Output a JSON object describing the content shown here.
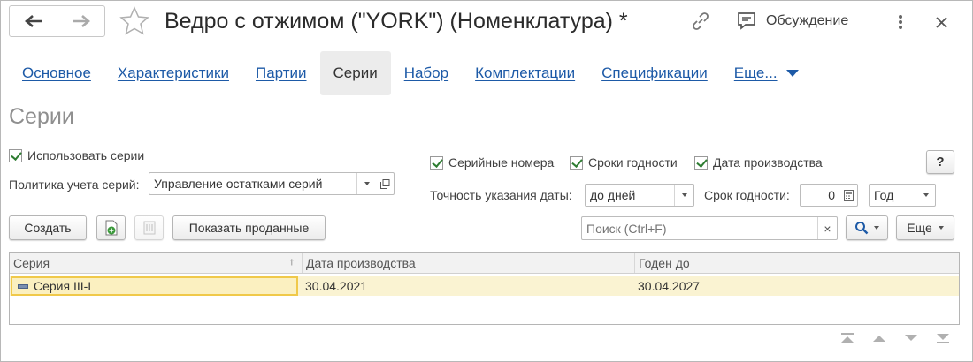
{
  "window": {
    "title": "Ведро с отжимом (\"YORK\") (Номенклатура) *",
    "discussion_label": "Обсуждение"
  },
  "tabs": [
    {
      "label": "Основное",
      "active": false
    },
    {
      "label": "Характеристики",
      "active": false
    },
    {
      "label": "Партии",
      "active": false
    },
    {
      "label": "Серии",
      "active": true
    },
    {
      "label": "Набор",
      "active": false
    },
    {
      "label": "Комплектации",
      "active": false
    },
    {
      "label": "Спецификации",
      "active": false
    },
    {
      "label": "Еще...",
      "active": false
    }
  ],
  "section_title": "Серии",
  "settings": {
    "use_series_label": "Использовать серии",
    "use_series_checked": true,
    "policy_label": "Политика учета серий:",
    "policy_value": "Управление остатками серий",
    "serial_numbers_label": "Серийные номера",
    "expiry_label": "Сроки годности",
    "production_date_label": "Дата производства",
    "date_precision_label": "Точность указания даты:",
    "date_precision_value": "до дней",
    "shelf_life_label": "Срок годности:",
    "shelf_life_value": "0",
    "shelf_life_unit": "Год",
    "help_label": "?"
  },
  "toolbar": {
    "create_label": "Создать",
    "show_sold_label": "Показать проданные",
    "search_placeholder": "Поиск (Ctrl+F)",
    "clear_label": "×",
    "more_label": "Еще"
  },
  "table": {
    "columns": [
      "Серия",
      "Дата производства",
      "Годен до"
    ],
    "sort_indicator": "↑",
    "rows": [
      {
        "series": "Серия III-I",
        "production_date": "30.04.2021",
        "expiry_date": "30.04.2027"
      }
    ]
  },
  "colors": {
    "link": "#1d5aa7",
    "check": "#2e7d32",
    "selected_row": "#faf3d2",
    "selection_border": "#f0c94a"
  }
}
